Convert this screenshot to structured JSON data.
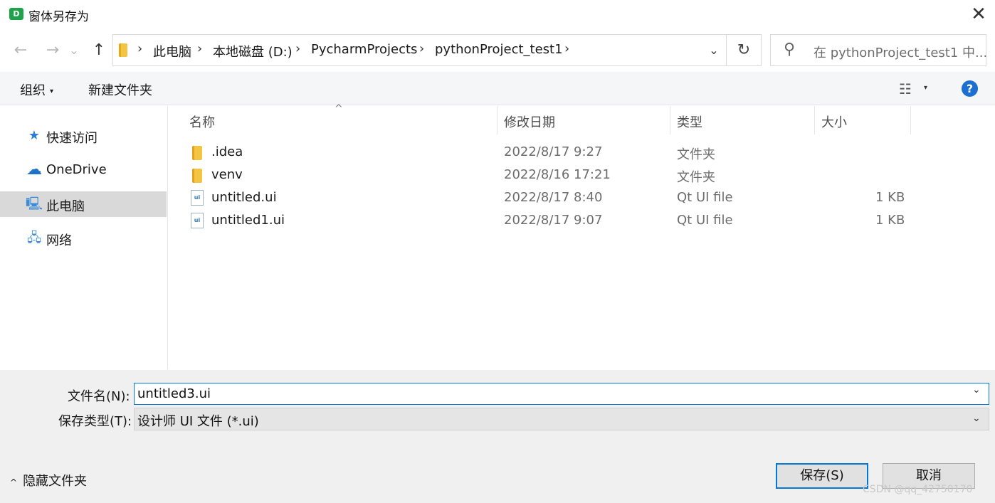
{
  "window": {
    "app_icon_letter": "D",
    "title": "窗体另存为",
    "close_glyph": "✕"
  },
  "nav": {
    "back_glyph": "←",
    "forward_glyph": "→",
    "recent_glyph": "⌄",
    "up_glyph": "↑"
  },
  "address": {
    "chevron": "›",
    "crumbs": [
      "此电脑",
      "本地磁盘 (D:)",
      "PycharmProjects",
      "pythonProject_test1"
    ],
    "dropdown_glyph": "⌄",
    "refresh_glyph": "↻"
  },
  "search": {
    "placeholder": "在 pythonProject_test1 中..."
  },
  "toolbar": {
    "organize_label": "组织",
    "new_folder_label": "新建文件夹",
    "caret": "▾",
    "view_glyph": "☷",
    "help_glyph": "?"
  },
  "sidebar": {
    "items": [
      {
        "label": "快速访问",
        "icon": "star-icon",
        "glyph": "★"
      },
      {
        "label": "OneDrive",
        "icon": "cloud-icon",
        "glyph": "☁"
      },
      {
        "label": "此电脑",
        "icon": "computer-icon",
        "glyph": "🖳"
      },
      {
        "label": "网络",
        "icon": "network-icon",
        "glyph": "🖧"
      }
    ],
    "selected": "此电脑"
  },
  "files": {
    "columns": [
      "名称",
      "修改日期",
      "类型",
      "大小"
    ],
    "sort_glyph": "^",
    "rows": [
      {
        "name": ".idea",
        "date": "2022/8/17 9:27",
        "type": "文件夹",
        "size": "",
        "icon": "folder-icon"
      },
      {
        "name": "venv",
        "date": "2022/8/16 17:21",
        "type": "文件夹",
        "size": "",
        "icon": "folder-icon"
      },
      {
        "name": "untitled.ui",
        "date": "2022/8/17 8:40",
        "type": "Qt UI file",
        "size": "1 KB",
        "icon": "ui-file-icon"
      },
      {
        "name": "untitled1.ui",
        "date": "2022/8/17 9:07",
        "type": "Qt UI file",
        "size": "1 KB",
        "icon": "ui-file-icon"
      }
    ]
  },
  "bottom": {
    "filename_label": "文件名(N):",
    "filename_value": "untitled3.ui",
    "filetype_label": "保存类型(T):",
    "filetype_value": "设计师 UI 文件 (*.ui)",
    "dropdown_glyph": "⌄",
    "hide_folders_label": "隐藏文件夹",
    "hide_caret": "^",
    "save_label": "保存(S)",
    "cancel_label": "取消",
    "watermark": "CSDN @qq_42750170"
  },
  "colors": {
    "accent": "#0078d7",
    "selection": "#d9d9d9",
    "help": "#1c6fd0",
    "folder": "#f4c542"
  }
}
